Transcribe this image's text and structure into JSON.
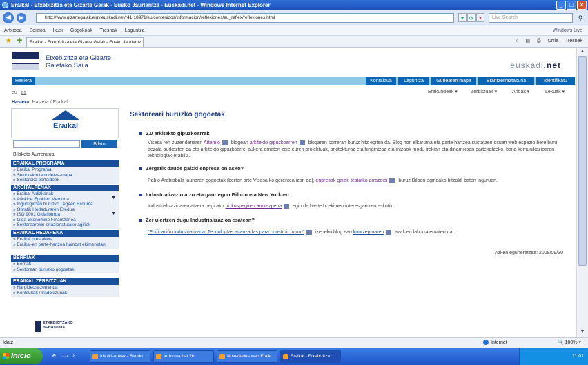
{
  "window": {
    "title": "Eraikal - Etxebizitza eta Gizarte Gaiak - Eusko Jaurlaritza - Euskadi.net - Windows Internet Explorer"
  },
  "address": {
    "url": "http://www.gizartegaiak.ejgv.euskadi.net/r41-18971/eu/contenidos/informacion/reflexiones/eu_reflex/reflexiones.html",
    "search_placeholder": "Live Search"
  },
  "menubar": {
    "items": [
      "Artxiboa",
      "Edizioa",
      "Ikusi",
      "Gogokoak",
      "Tresnak",
      "Laguntza"
    ],
    "brand": "Windows Live"
  },
  "tab": {
    "label": "Eraikal - Etxebizitza eta Gizarte Gaiak - Eusko Jaurlaritz..."
  },
  "commandbar": {
    "page": "Orria",
    "tools": "Tresnak"
  },
  "header": {
    "dept_line1": "Etxebizitza eta Gizarte",
    "dept_line2": "Gaietako Saila",
    "euskadi_a": "euskadi",
    "euskadi_b": ".net"
  },
  "topnav": {
    "home_tab": "Hasiera",
    "links": [
      "Kontaktua",
      "Laguntza",
      "Gunearen mapa",
      "Erantzerraztasuna",
      "Identifikatu"
    ]
  },
  "lang": {
    "eu": "eu",
    "es": "es"
  },
  "breadcrumb": {
    "label": "Hasiera:",
    "path": "Hasiera / Eraikal"
  },
  "dropdowns": [
    "Erakundeak",
    "Zerbitzuak",
    "Arloak",
    "Lekuak"
  ],
  "sidebar": {
    "logo": "Eraikal",
    "search_button": "Bilatu",
    "advanced_search": "Bilaketa Aurreratua",
    "sections": [
      {
        "title": "ERAIKAL PROGRAMA",
        "items": [
          "» Eraikal Programa",
          "» Sektorekin lankidetza-mapa",
          "» Sektoreko partaideak"
        ]
      },
      {
        "title": "ARGITALPENAK",
        "items": [
          "» Eraikal Aldizkariak",
          "» Arlokide Egokien Memoria",
          "» Ingurugiroari buruzko Legeen Bilduma",
          "» Obratik Hedaduraren Eredua",
          "» ISO 9001 Gidaliburua",
          "» Gida Ekonomiko Finantzarioa",
          "» Sektorearekin erlazionatutako agiriak"
        ]
      },
      {
        "title": "ERAIKAL HEDAPENA",
        "items": [
          "» Eraikal prestaketa",
          "» Eraikal-en parte-hartzea hainbat ekimenetan"
        ]
      },
      {
        "title": "BERRIAK",
        "items": [
          "» Berriak",
          "» Sektoreari buruzko gogoetak"
        ]
      },
      {
        "title": "ERAIKAL ZERBITZUAK",
        "items": [
          "» Harpidetza-zerrenda",
          "» Kontsultak / Iradokizunak"
        ]
      }
    ],
    "seal_line1": "ETXEBIZITZAKO",
    "seal_line2": "BEHATOKIA"
  },
  "main": {
    "heading": "Sektoreari buruzko gogoetak",
    "items": [
      {
        "title": "2.0 arkitekto gipuzkoarrak",
        "text_a": "Visesa ren zuzendariaren ",
        "link_a": "Artemio",
        "text_b": " blogean ",
        "link_b": "arkitekto gipuzkoarren",
        "text_c": " blogaren sorreran buruz hitz egiten da. Blog hori elkarlana eta parte hartzea sustatzen dituen web espazio bere buru bezala aurkezten da eta arkitekto gipuzkoarrei aukera ematen zaie euren proiektuak, arkitekturaz eta hirigintzaz eta intzaok modu irekian eta dinamikoan partekatzeko, baita komunikazioaren teknologiak erabiliz."
      },
      {
        "title": "Zergatik daude gaizki enpresa on asko?",
        "text_a": "Pablo Arebiabala jaunaren gogoetak (bertan arte Visesa ko gerentea izan da), ",
        "link_a": "enpresak gaizki testatko arrazoiei",
        "text_b": " buruz Bilbon egindako hitzaldi baten inguruan."
      },
      {
        "title": "Industrializazio atzo eta gaur egun Bilbon eta New York-en",
        "text_a": "Industrializazioaren atzera begirako ",
        "link_a": "bi ikuspegiren aurkezpena",
        "text_b": " egin da baste bi ekimen interesgarriren eskutik."
      },
      {
        "title": "Zer ulertzen dugu Industrializazioa esatean?",
        "text_a": "",
        "link_a": "\"Edificación industrializada, Tecnologías avanzadas para construir futuro\"",
        "text_b": " izeneko blog ean ",
        "link_b": "kontzeptuaren",
        "text_c": " azalpen laburra ematen da."
      }
    ],
    "updated": "Azken eguneratzea: 2008/09/30"
  },
  "status": {
    "left": "Idatz",
    "zone": "Internet",
    "zoom": "100%"
  },
  "taskbar": {
    "start": "Inicio",
    "buttons": [
      "Idazki-Apkaz - Bando...",
      "artikulua bat 2b",
      "Novedades web Eraik...",
      "Eraikal - Etxebizitza..."
    ],
    "clock": "11:01"
  }
}
